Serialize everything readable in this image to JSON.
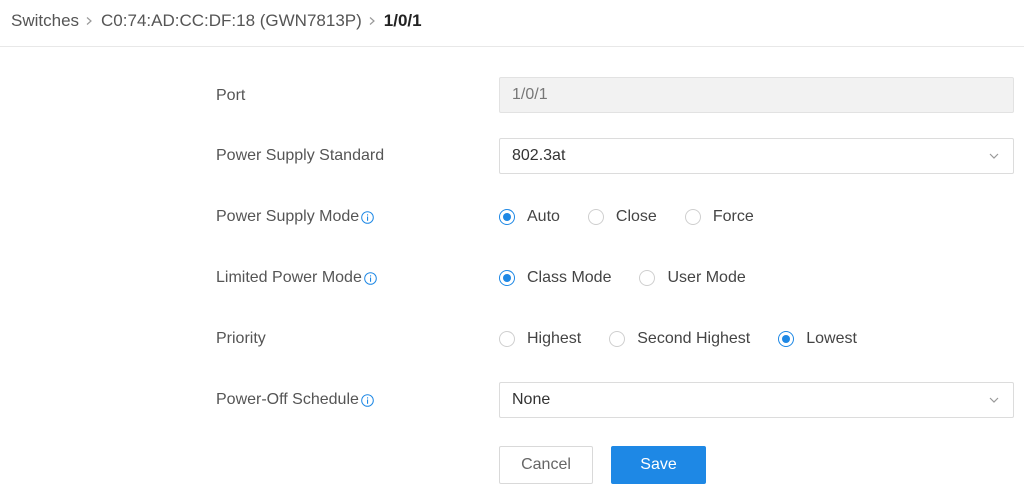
{
  "breadcrumb": {
    "items": [
      "Switches",
      "C0:74:AD:CC:DF:18 (GWN7813P)"
    ],
    "current": "1/0/1"
  },
  "form": {
    "port": {
      "label": "Port",
      "value": "1/0/1"
    },
    "power_supply_standard": {
      "label": "Power Supply Standard",
      "value": "802.3at"
    },
    "power_supply_mode": {
      "label": "Power Supply Mode",
      "options": [
        "Auto",
        "Close",
        "Force"
      ],
      "selected": "Auto"
    },
    "limited_power_mode": {
      "label": "Limited Power Mode",
      "options": [
        "Class Mode",
        "User Mode"
      ],
      "selected": "Class Mode"
    },
    "priority": {
      "label": "Priority",
      "options": [
        "Highest",
        "Second Highest",
        "Lowest"
      ],
      "selected": "Lowest"
    },
    "power_off_schedule": {
      "label": "Power-Off Schedule",
      "value": "None"
    }
  },
  "actions": {
    "cancel_label": "Cancel",
    "save_label": "Save"
  },
  "icons": {
    "breadcrumb_separator": "chevron-right-icon",
    "info": "info-icon",
    "dropdown": "chevron-down-icon"
  },
  "colors": {
    "accent": "#1e88e5",
    "label_text": "#555555",
    "disabled_field_bg": "#f2f2f2"
  }
}
